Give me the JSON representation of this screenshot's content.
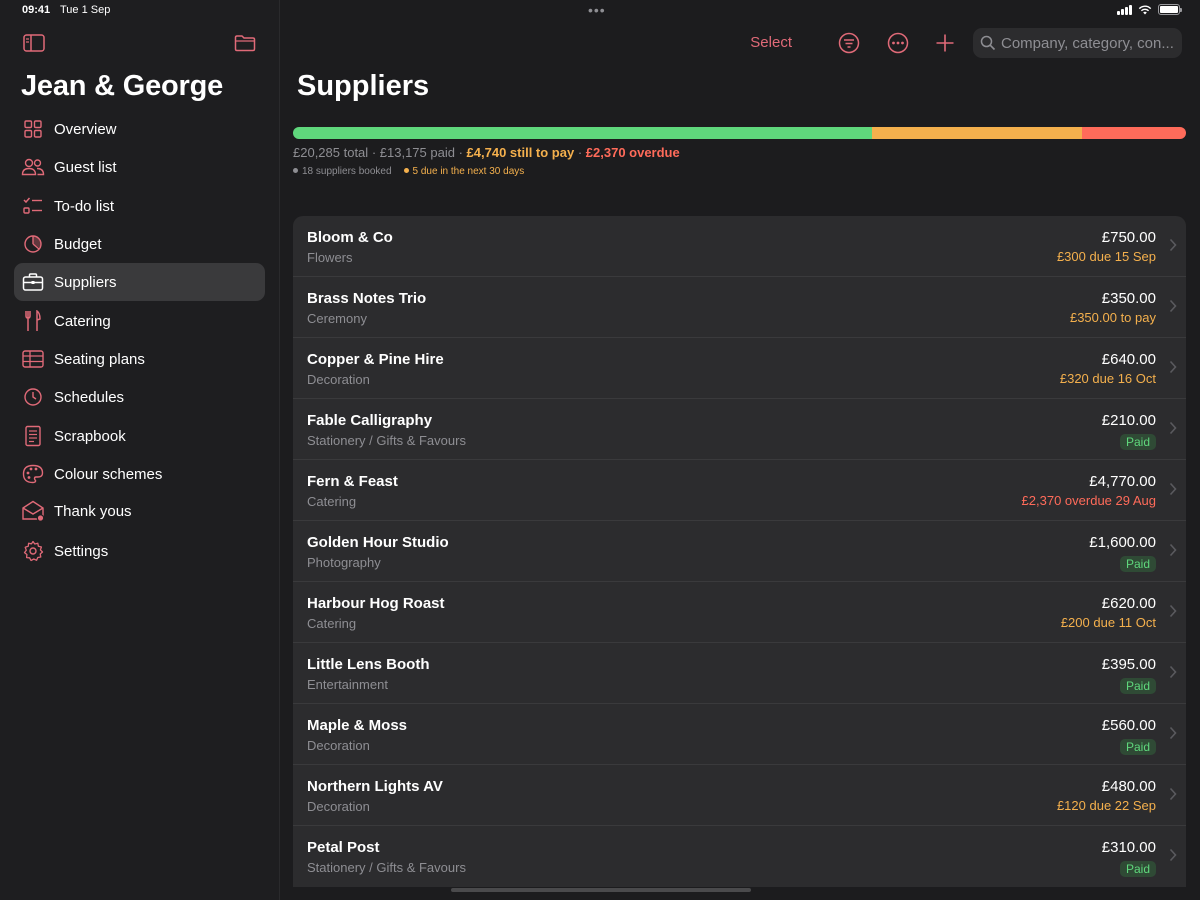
{
  "status_bar": {
    "time": "09:41",
    "date": "Tue 1 Sep"
  },
  "colors": {
    "accent": "#e06a78",
    "paid": "#5fd77c",
    "due": "#f4b04d",
    "overdue": "#ff6b5a"
  },
  "sidebar": {
    "title": "Jean & George",
    "toggle_icon": "sidebar-toggle-icon",
    "folder_icon": "folder-icon",
    "items": [
      {
        "label": "Overview",
        "icon": "grid-icon"
      },
      {
        "label": "Guest list",
        "icon": "people-icon"
      },
      {
        "label": "To-do list",
        "icon": "checklist-icon"
      },
      {
        "label": "Budget",
        "icon": "pie-chart-icon"
      },
      {
        "label": "Suppliers",
        "icon": "briefcase-icon",
        "active": true
      },
      {
        "label": "Catering",
        "icon": "fork-knife-icon"
      },
      {
        "label": "Seating plans",
        "icon": "table-icon"
      },
      {
        "label": "Schedules",
        "icon": "clock-icon"
      },
      {
        "label": "Scrapbook",
        "icon": "notebook-icon"
      },
      {
        "label": "Colour schemes",
        "icon": "palette-icon"
      },
      {
        "label": "Thank yous",
        "icon": "envelope-icon"
      },
      {
        "label": "Settings",
        "icon": "gear-icon"
      }
    ]
  },
  "toolbar": {
    "select_label": "Select",
    "filter_icon": "filter-icon",
    "more_icon": "ellipsis-circle-icon",
    "add_icon": "plus-icon",
    "search_placeholder": "Company, category, con..."
  },
  "main": {
    "title": "Suppliers",
    "progress": {
      "paid_fraction": 0.65,
      "due_fraction": 0.235,
      "overdue_fraction": 0.117
    },
    "summary": {
      "total": "£20,285 total",
      "paid": "£13,175 paid",
      "still_to_pay": "£4,740 still to pay",
      "overdue": "£2,370 overdue",
      "booked": "18 suppliers booked",
      "due_soon": "5 due in the next 30 days"
    },
    "suppliers": [
      {
        "name": "Bloom & Co",
        "category": "Flowers",
        "amount": "£750.00",
        "status": "£300 due 15 Sep",
        "status_type": "due"
      },
      {
        "name": "Brass Notes Trio",
        "category": "Ceremony",
        "amount": "£350.00",
        "status": "£350.00 to pay",
        "status_type": "topay"
      },
      {
        "name": "Copper & Pine Hire",
        "category": "Decoration",
        "amount": "£640.00",
        "status": "£320 due 16 Oct",
        "status_type": "due"
      },
      {
        "name": "Fable Calligraphy",
        "category": "Stationery / Gifts & Favours",
        "amount": "£210.00",
        "status": "Paid",
        "status_type": "paid"
      },
      {
        "name": "Fern & Feast",
        "category": "Catering",
        "amount": "£4,770.00",
        "status": "£2,370 overdue 29 Aug",
        "status_type": "overdue"
      },
      {
        "name": "Golden Hour Studio",
        "category": "Photography",
        "amount": "£1,600.00",
        "status": "Paid",
        "status_type": "paid"
      },
      {
        "name": "Harbour Hog Roast",
        "category": "Catering",
        "amount": "£620.00",
        "status": "£200 due 11 Oct",
        "status_type": "due"
      },
      {
        "name": "Little Lens Booth",
        "category": "Entertainment",
        "amount": "£395.00",
        "status": "Paid",
        "status_type": "paid"
      },
      {
        "name": "Maple & Moss",
        "category": "Decoration",
        "amount": "£560.00",
        "status": "Paid",
        "status_type": "paid"
      },
      {
        "name": "Northern Lights AV",
        "category": "Decoration",
        "amount": "£480.00",
        "status": "£120 due 22 Sep",
        "status_type": "due"
      },
      {
        "name": "Petal Post",
        "category": "Stationery / Gifts & Favours",
        "amount": "£310.00",
        "status": "Paid",
        "status_type": "paid"
      }
    ]
  }
}
